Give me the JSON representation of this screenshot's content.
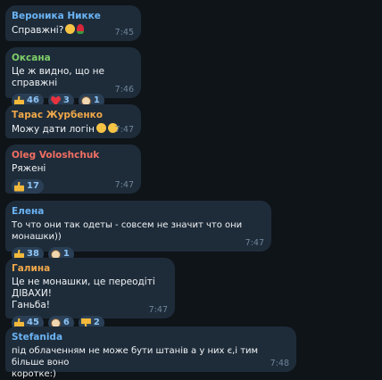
{
  "colors": {
    "background": "#0f1419",
    "bubble": "#1e2c3a",
    "reaction_chip": "#2a3f55",
    "reaction_text": "#8cc3f5",
    "time": "#708499"
  },
  "messages": [
    {
      "author": "Вероника Никке",
      "author_color": "#6ab3f3",
      "text": "Справжні?",
      "emoji": [
        "grin-face-icon",
        "rose-icon"
      ],
      "time": "7:45",
      "reactions": []
    },
    {
      "author": "Оксана",
      "author_color": "#7fd069",
      "text": "Це ж видно, що не справжні",
      "time": "7:46",
      "reactions": [
        {
          "icon": "thumbs-up-icon",
          "count": "46"
        },
        {
          "icon": "heart-icon",
          "count": "3"
        },
        {
          "icon": "cow-icon",
          "count": "1"
        }
      ]
    },
    {
      "author": "Тарас Журбенко",
      "author_color": "#f0a84a",
      "text": "Можу дати логін",
      "emoji": [
        "grin-face-icon",
        "grin-face-icon"
      ],
      "time": "7:47",
      "reactions": []
    },
    {
      "author": "Oleg Voloshchuk",
      "author_color": "#f26f63",
      "text": "Ряжені",
      "time": "7:47",
      "reactions": [
        {
          "icon": "thumbs-up-icon",
          "count": "17"
        }
      ]
    },
    {
      "author": "Елена",
      "author_color": "#6ab3f3",
      "text": "То что они так одеты - совсем не значит что они монашки))",
      "time": "7:47",
      "reactions": [
        {
          "icon": "thumbs-up-icon",
          "count": "38"
        },
        {
          "icon": "cow-icon",
          "count": "1"
        }
      ]
    },
    {
      "author": "Галина",
      "author_color": "#f0a84a",
      "text": "Це не монашки, це переодіті ДІВАХИ!\nГаньба!",
      "time": "7:47",
      "reactions": [
        {
          "icon": "thumbs-up-icon",
          "count": "45"
        },
        {
          "icon": "cow-icon",
          "count": "6"
        },
        {
          "icon": "thumbs-down-icon",
          "count": "2"
        }
      ]
    },
    {
      "author": "Stefanida",
      "author_color": "#6ab3f3",
      "text": "під облаченням не може бути штанів а у них є,і тим більше воно\nкоротке:)",
      "time": "7:48",
      "reactions": []
    }
  ]
}
